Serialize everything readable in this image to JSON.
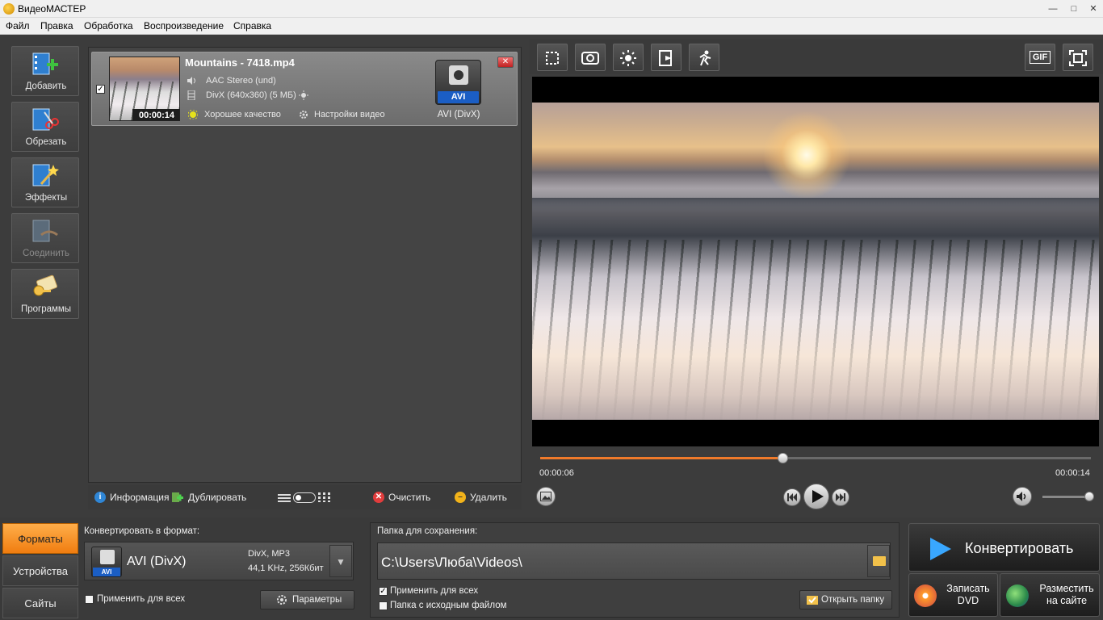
{
  "window": {
    "title": "ВидеоМАСТЕР"
  },
  "menu": [
    "Файл",
    "Правка",
    "Обработка",
    "Воспроизведение",
    "Справка"
  ],
  "tools": [
    {
      "label": "Добавить",
      "icon": "add-video-icon",
      "enabled": true
    },
    {
      "label": "Обрезать",
      "icon": "cut-video-icon",
      "enabled": true
    },
    {
      "label": "Эффекты",
      "icon": "effects-icon",
      "enabled": true
    },
    {
      "label": "Соединить",
      "icon": "join-icon",
      "enabled": false
    },
    {
      "label": "Программы",
      "icon": "programs-icon",
      "enabled": true
    }
  ],
  "file": {
    "name": "Mountains - 7418.mp4",
    "duration": "00:00:14",
    "audio": "AAC Stereo (und)",
    "video": "DivX (640x360) (5 МБ)",
    "quality": "Хорошее качество",
    "settings": "Настройки видео",
    "badge": "AVI",
    "format_label": "AVI (DivX)",
    "checked": true
  },
  "list_toolbar": {
    "info": "Информация",
    "duplicate": "Дублировать",
    "clear": "Очистить",
    "delete": "Удалить"
  },
  "player": {
    "current_time": "00:00:06",
    "end_time": "00:00:14",
    "progress": 0.44,
    "volume": 0.9,
    "gif_label": "GIF"
  },
  "bottom_tabs": [
    {
      "label": "Форматы",
      "active": true
    },
    {
      "label": "Устройства",
      "active": false
    },
    {
      "label": "Сайты",
      "active": false
    }
  ],
  "format_panel": {
    "heading": "Конвертировать в формат:",
    "format_name": "AVI (DivX)",
    "badge": "AVI",
    "codec_line1": "DivX, MP3",
    "codec_line2": "44,1 KHz, 256Кбит",
    "apply_all": "Применить для всех",
    "params_button": "Параметры"
  },
  "save_panel": {
    "heading": "Папка для сохранения:",
    "path": "C:\\Users\\Люба\\Videos\\",
    "apply_all": "Применить для всех",
    "apply_all_checked": true,
    "source_folder": "Папка с исходным файлом",
    "source_folder_checked": false,
    "open_folder": "Открыть папку"
  },
  "actions": {
    "convert": "Конвертировать",
    "dvd_line1": "Записать",
    "dvd_line2": "DVD",
    "web_line1": "Разместить",
    "web_line2": "на сайте"
  },
  "colors": {
    "accent": "#f07d10",
    "progress": "#f07a2a",
    "avi_badge": "#1b5ec4",
    "convert_arrow": "#39a7ff"
  }
}
